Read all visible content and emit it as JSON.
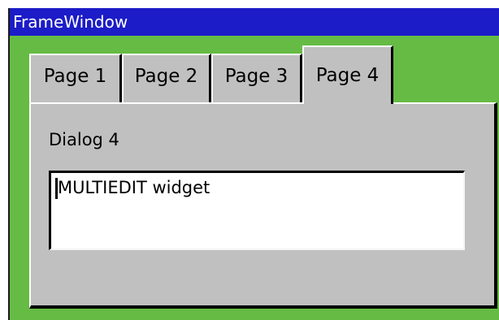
{
  "window": {
    "title": "FrameWindow"
  },
  "tabs": [
    {
      "label": "Page 1",
      "active": false
    },
    {
      "label": "Page 2",
      "active": false
    },
    {
      "label": "Page 3",
      "active": false
    },
    {
      "label": "Page 4",
      "active": true
    }
  ],
  "panel": {
    "dialog_label": "Dialog 4",
    "multiedit_value": "MULTIEDIT widget"
  },
  "colors": {
    "client_background": "#66bb44",
    "titlebar": "#1c1cc8",
    "panel": "#c0c0c0"
  }
}
